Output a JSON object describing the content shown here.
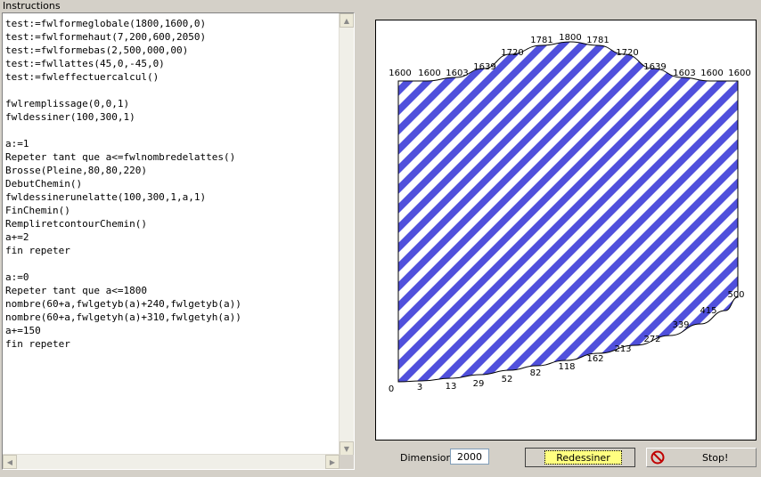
{
  "panel": {
    "title": "Instructions"
  },
  "editor": {
    "code": "test:=fwlformeglobale(1800,1600,0)\ntest:=fwlformehaut(7,200,600,2050)\ntest:=fwlformebas(2,500,000,00)\ntest:=fwllattes(45,0,-45,0)\ntest:=fwleffectuercalcul()\n\nfwlremplissage(0,0,1)\nfwldessiner(100,300,1)\n\na:=1\nRepeter tant que a<=fwlnombredelattes()\nBrosse(Pleine,80,80,220)\nDebutChemin()\nfwldessinerunelatte(100,300,1,a,1)\nFinChemin()\nRempliretcontourChemin()\na+=2\nfin repeter\n\na:=0\nRepeter tant que a<=1800\nnombre(60+a,fwlgetyb(a)+240,fwlgetyb(a))\nnombre(60+a,fwlgetyh(a)+310,fwlgetyh(a))\na+=150\nfin repeter"
  },
  "drawing": {
    "stripe_color": "#5050dc",
    "top_values": [
      "1600",
      "1600",
      "1603",
      "1639",
      "1720",
      "1781",
      "1800",
      "1781",
      "1720",
      "1639",
      "1603",
      "1600",
      "1600"
    ],
    "bottom_values": [
      "0",
      "3",
      "13",
      "29",
      "52",
      "82",
      "118",
      "162",
      "213",
      "272",
      "339",
      "415",
      "500"
    ]
  },
  "controls": {
    "dimension_label": "Dimension",
    "dimension_value": "2000",
    "redraw_label": "Redessiner",
    "stop_label": "Stop!"
  },
  "icons": {
    "redraw": "hand-pointer-icon",
    "stop": "stop-sign-icon"
  }
}
